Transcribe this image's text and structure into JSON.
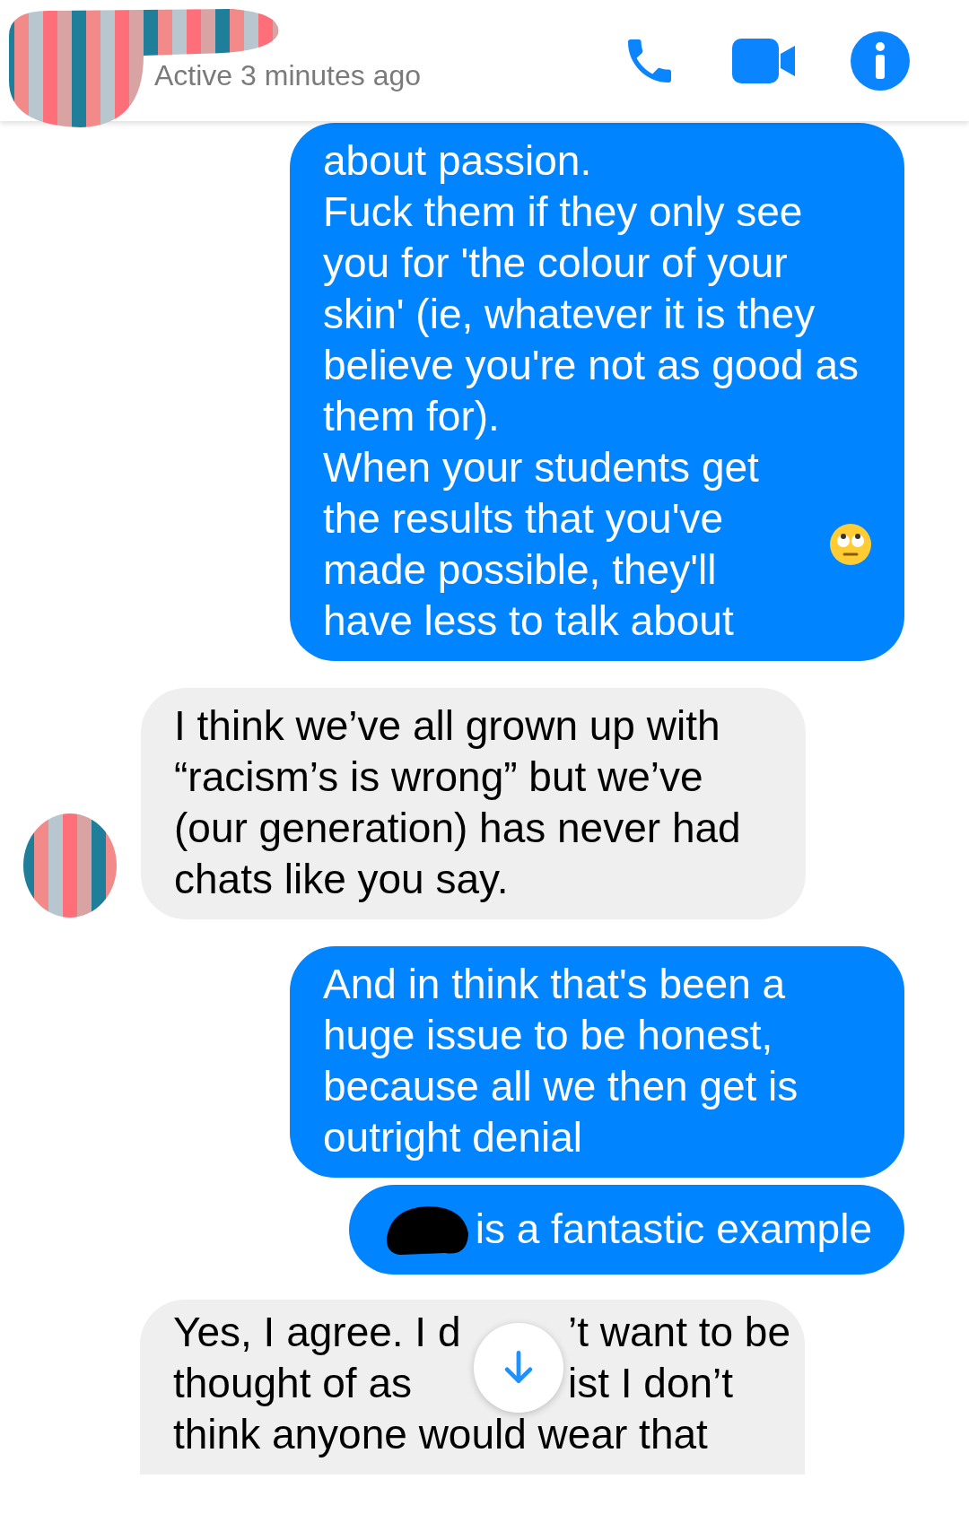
{
  "header": {
    "status": "Active 3 minutes ago"
  },
  "messages": [
    {
      "kind": "sent",
      "paragraphs": [
        "about passion.",
        "Fuck them if they only see you for 'the colour of your skin' (ie, whatever it is they believe you're not as good as them for).",
        "When your students get the results that you've made possible, they'll have less to talk about"
      ],
      "emoji": true
    },
    {
      "kind": "received",
      "paragraphs": [
        "I think we’ve all grown up with “racism’s is wrong” but we’ve (our generation) has never had chats like you say."
      ],
      "avatar": true
    },
    {
      "kind": "sent",
      "paragraphs": [
        "And in think that's been a huge issue to be honest, because all we then get is outright denial"
      ]
    },
    {
      "kind": "sent",
      "paragraphs": [
        "is a fantastic example"
      ],
      "redacted": true
    },
    {
      "kind": "partial",
      "lines": [
        [
          "Yes, I agree. I d",
          "’t want to be"
        ],
        [
          "thought of as",
          "ist I don’t"
        ],
        [
          "think anyone would wear that"
        ]
      ]
    }
  ]
}
